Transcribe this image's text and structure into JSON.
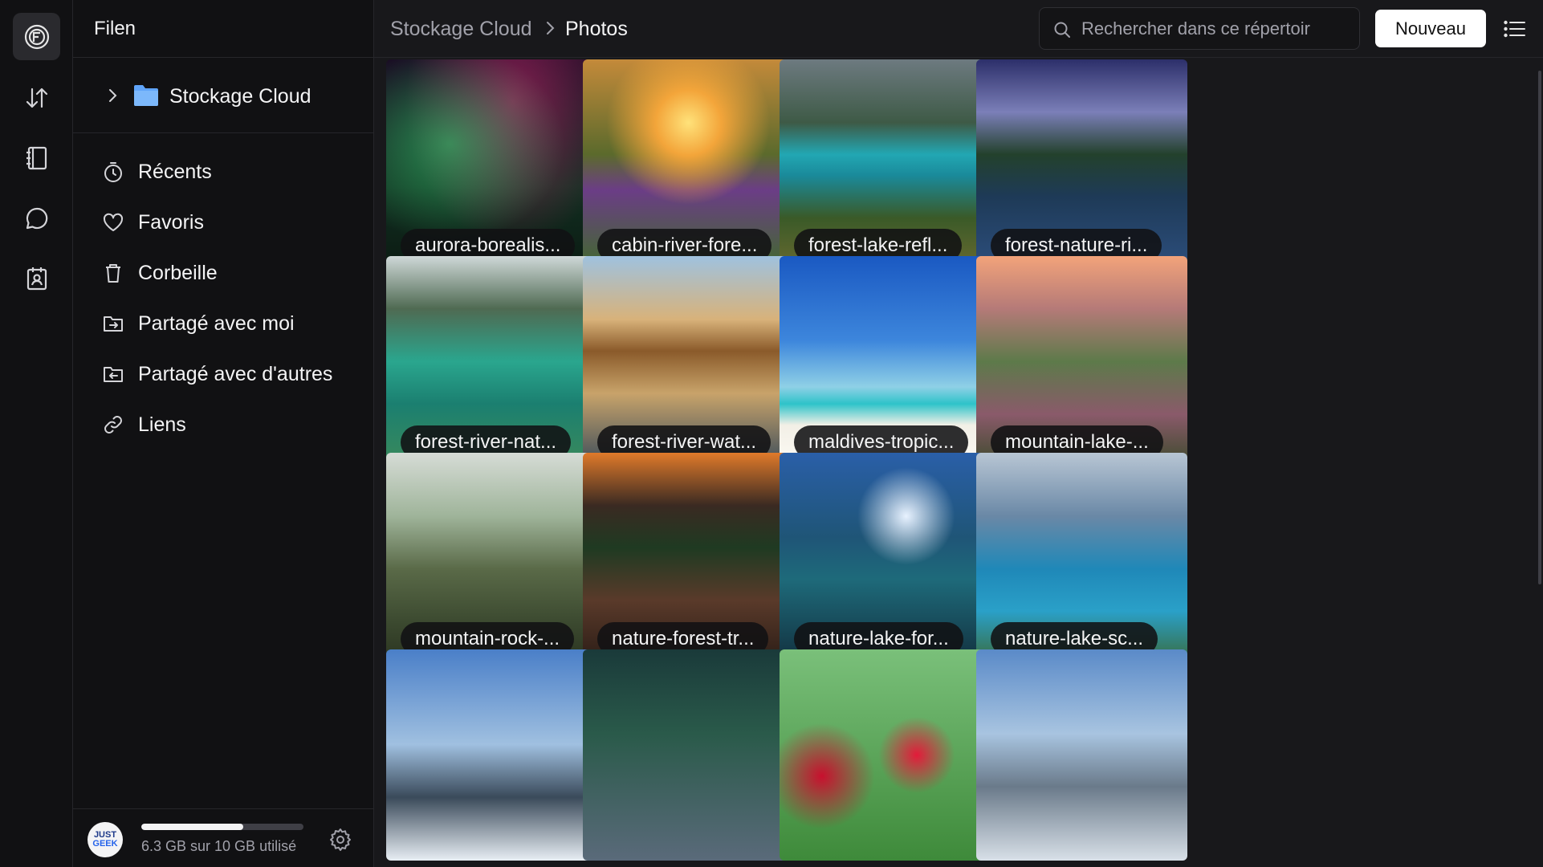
{
  "app": {
    "title": "Filen"
  },
  "rail": {
    "items": [
      {
        "icon": "filen-logo-icon"
      },
      {
        "icon": "transfers-icon"
      },
      {
        "icon": "notes-icon"
      },
      {
        "icon": "chat-icon"
      },
      {
        "icon": "contacts-icon"
      }
    ]
  },
  "sidebar": {
    "root_folder": "Stockage Cloud",
    "nav": [
      {
        "label": "Récents",
        "icon": "clock-icon"
      },
      {
        "label": "Favoris",
        "icon": "heart-icon"
      },
      {
        "label": "Corbeille",
        "icon": "trash-icon"
      },
      {
        "label": "Partagé avec moi",
        "icon": "shared-in-icon"
      },
      {
        "label": "Partagé avec d'autres",
        "icon": "shared-out-icon"
      },
      {
        "label": "Liens",
        "icon": "link-icon"
      }
    ],
    "storage": {
      "text": "6.3 GB sur 10 GB utilisé",
      "used_fraction": 0.63
    },
    "avatar": {
      "line1": "JUST",
      "line2": "GEEK"
    }
  },
  "header": {
    "breadcrumb": [
      "Stockage Cloud",
      "Photos"
    ],
    "search_placeholder": "Rechercher dans ce répertoir",
    "new_button": "Nouveau"
  },
  "files": [
    {
      "name": "aurora-borealis..."
    },
    {
      "name": "cabin-river-fore..."
    },
    {
      "name": "forest-lake-refl..."
    },
    {
      "name": "forest-nature-ri..."
    },
    {
      "name": "forest-river-nat..."
    },
    {
      "name": "forest-river-wat..."
    },
    {
      "name": "maldives-tropic..."
    },
    {
      "name": "mountain-lake-..."
    },
    {
      "name": "mountain-rock-..."
    },
    {
      "name": "nature-forest-tr..."
    },
    {
      "name": "nature-lake-for..."
    },
    {
      "name": "nature-lake-sc..."
    },
    {
      "name": ""
    },
    {
      "name": ""
    },
    {
      "name": ""
    },
    {
      "name": ""
    }
  ],
  "colors": {
    "background": "#18181b",
    "sidebar": "#111113",
    "accent_folder": "#60a5fa"
  }
}
